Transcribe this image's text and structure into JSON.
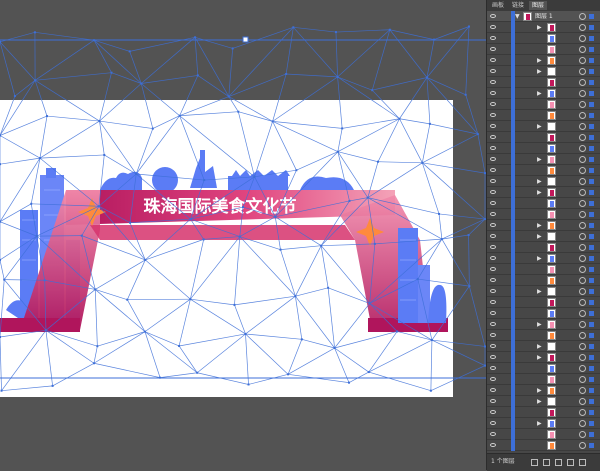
{
  "panel": {
    "tabs": [
      "画板",
      "链接",
      "图层"
    ],
    "active_tab_index": 2,
    "parent_layer_name": "图层 1",
    "layer_count_label": "1 个图层"
  },
  "artwork": {
    "title": "珠海国际美食文化节",
    "colors": {
      "gradient_start": "#c2185b",
      "gradient_end": "#f48fb1",
      "building_blue": "#5b7cf5",
      "star_orange": "#ff8a3d",
      "mesh_line": "#3d6fd8",
      "base_magenta": "#b0155c"
    }
  },
  "icons": {
    "eye": "eye-icon",
    "expand": "triangle-right-icon",
    "target": "target-circle-icon"
  }
}
